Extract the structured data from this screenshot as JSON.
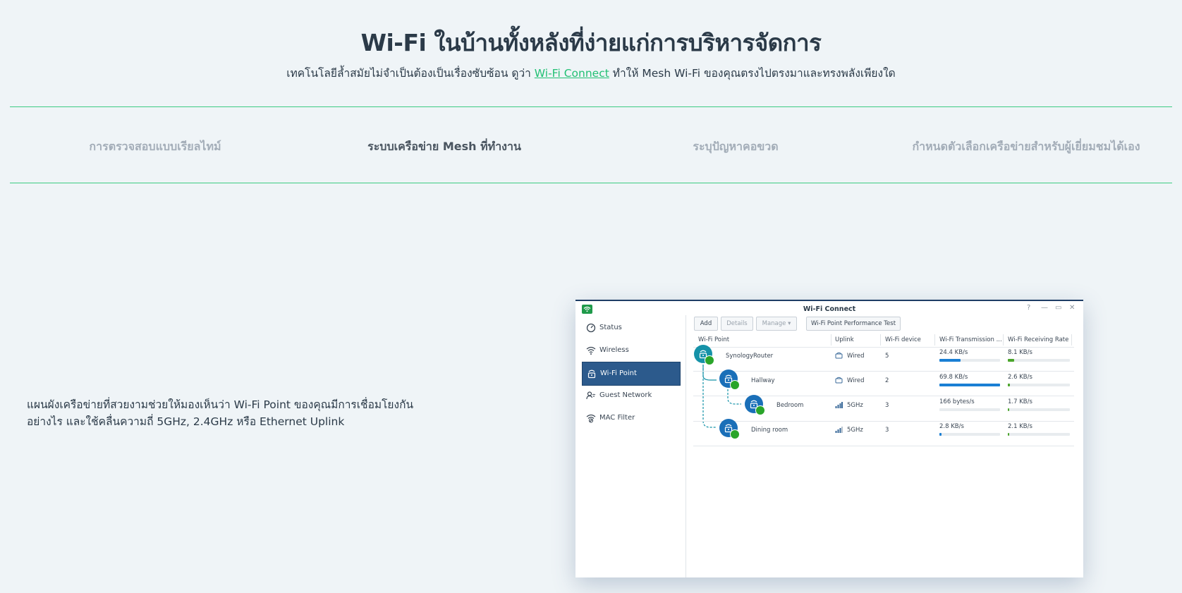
{
  "page": {
    "title": "Wi-Fi ในบ้านทั้งหลังที่ง่ายแก่การบริหารจัดการ",
    "subtitle_before": "เทคโนโลยีล้ำสมัยไม่จำเป็นต้องเป็นเรื่องซับซ้อน ดูว่า ",
    "subtitle_link": "Wi-Fi Connect",
    "subtitle_after": " ทำให้ Mesh Wi-Fi ของคุณตรงไปตรงมาและทรงพลังเพียงใด",
    "accent_color": "#22c074"
  },
  "tabs": [
    {
      "label": "การตรวจสอบแบบเรียลไทม์"
    },
    {
      "label": "ระบบเครือข่าย Mesh ที่ทำงาน"
    },
    {
      "label": "ระบุปัญหาคอขวด"
    },
    {
      "label": "กำหนดตัวเลือกเครือข่ายสำหรับผู้เยี่ยมชมได้เอง"
    }
  ],
  "description": {
    "line1": "แผนผังเครือข่ายที่สวยงามช่วยให้มองเห็นว่า Wi-Fi Point ของคุณมีการเชื่อมโยงกัน",
    "line2": "อย่างไร และใช้คลื่นความถี่ 5GHz, 2.4GHz หรือ Ethernet Uplink"
  },
  "window": {
    "title": "Wi-Fi Connect",
    "controls": {
      "help": "?",
      "minimize": "—",
      "maximize": "▭",
      "close": "✕"
    },
    "sidebar": [
      {
        "label": "Status",
        "icon": "status-gauge-icon"
      },
      {
        "label": "Wireless",
        "icon": "wifi-icon"
      },
      {
        "label": "Wi-Fi Point",
        "icon": "router-icon"
      },
      {
        "label": "Guest Network",
        "icon": "guest-icon"
      },
      {
        "label": "MAC Filter",
        "icon": "mac-filter-icon"
      }
    ],
    "toolbar": {
      "add": "Add",
      "details": "Details",
      "manage": "Manage ▾",
      "perf_test": "Wi-Fi Point Performance Test"
    },
    "columns": [
      "Wi-Fi Point",
      "Uplink",
      "Wi-Fi device",
      "Wi-Fi Transmission ...",
      "Wi-Fi Receiving Rate"
    ],
    "rows": [
      {
        "name": "SynologyRouter",
        "uplink": "Wired",
        "uplink_icon": "wired-icon",
        "devices": "5",
        "tx": "24.4 KB/s",
        "tx_fill": 0.35,
        "rx": "8.1 KB/s",
        "rx_fill": 0.1
      },
      {
        "name": "Hallway",
        "uplink": "Wired",
        "uplink_icon": "wired-icon",
        "devices": "2",
        "tx": "69.8 KB/s",
        "tx_fill": 1.0,
        "rx": "2.6 KB/s",
        "rx_fill": 0.03
      },
      {
        "name": "Bedroom",
        "uplink": "5GHz",
        "uplink_icon": "signal-icon",
        "devices": "3",
        "tx": "166 bytes/s",
        "tx_fill": 0.0,
        "rx": "1.7 KB/s",
        "rx_fill": 0.02
      },
      {
        "name": "Dining room",
        "uplink": "5GHz",
        "uplink_icon": "signal-icon",
        "devices": "3",
        "tx": "2.8 KB/s",
        "tx_fill": 0.03,
        "rx": "2.1 KB/s",
        "rx_fill": 0.02
      }
    ],
    "colors": {
      "tx_bar": "#1a7fd4",
      "rx_bar": "#4aa52a",
      "router_node": "#1592a8",
      "point_node": "#1a6fb8",
      "active_item": "#2c5a8c"
    }
  }
}
